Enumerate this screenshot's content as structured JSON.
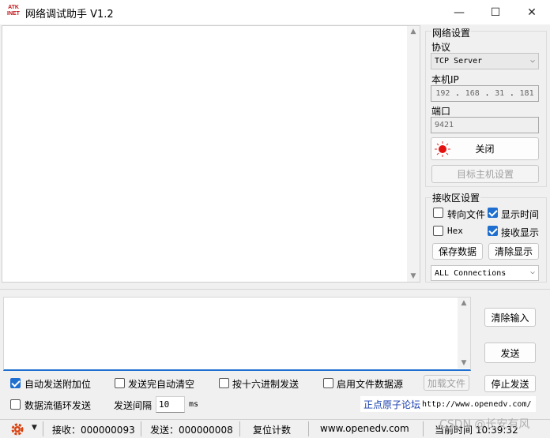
{
  "window": {
    "logo_line1": "ATK",
    "logo_line2": "INET",
    "title": "网络调试助手 V1.2",
    "minimize": "—",
    "maximize": "☐",
    "close": "✕"
  },
  "network": {
    "group_title": "网络设置",
    "protocol_label": "协议",
    "protocol_value": "TCP Server",
    "local_ip_label": "本机IP",
    "ip": [
      "192",
      "168",
      "31",
      "181"
    ],
    "port_label": "端口",
    "port_value": "9421",
    "close_button": "关闭",
    "target_host_button": "目标主机设置"
  },
  "receive": {
    "group_title": "接收区设置",
    "redirect_file": "转向文件",
    "show_time": "显示时间",
    "hex": "Hex",
    "show_receive": "接收显示",
    "save_data": "保存数据",
    "clear_display": "清除显示",
    "connections_value": "ALL Connections"
  },
  "send_buttons": {
    "clear_input": "清除输入",
    "send": "发送",
    "stop_send": "停止发送",
    "load_file": "加载文件"
  },
  "send_options": {
    "auto_append": "自动发送附加位",
    "auto_clear": "发送完自动清空",
    "hex_send": "按十六进制发送",
    "file_source": "启用文件数据源",
    "loop_send": "数据流循环发送",
    "interval_label": "发送间隔",
    "interval_value": "10",
    "interval_unit": "ms",
    "forum_name": "正点原子论坛",
    "forum_url": "http://www.openedv.com/"
  },
  "status": {
    "received": "接收：000000093",
    "sent": "发送：000000008",
    "reset_count": "复位计数",
    "website": "www.openedv.com",
    "current_time": "当前时间 10:39:32"
  },
  "watermark": "CSDN @长安有风",
  "colors": {
    "accent": "#1f6fd0",
    "logo_red": "#c0161b",
    "gear": "#d9420f",
    "forum_blue": "#1a3fae"
  }
}
